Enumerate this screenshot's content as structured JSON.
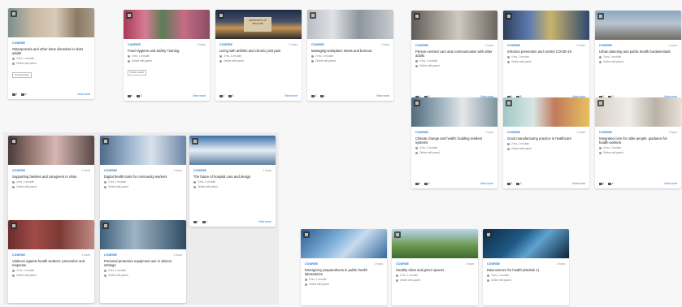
{
  "palette": {
    "accent": "#1a73c9",
    "page_background": "#f7f7f7",
    "panel_background": "#ececec",
    "card_background": "#ffffff"
  },
  "thumb_images": [
    "linear-gradient(90deg,#7a8f8c 0%,#c9b9a3 30%,#d8cbb8 55%,#8b7a63 80%,#a79c8a 100%)",
    "linear-gradient(90deg,#a93a57 0%,#d77b93 25%,#5b7c55 45%,#c56c87 70%,#8a4e63 100%)",
    "linear-gradient(180deg,#1f2b44 0%,#46506b 40%,#c79553 62%,#2a2a2a 100%)",
    "linear-gradient(90deg,#b9bdc4 0%,#dfe1e4 30%,#8e959d 60%,#c8ccd1 100%)",
    "linear-gradient(90deg,#5f5a55 0%,#a8a29a 35%,#cfc9c0 55%,#6a6560 100%)",
    "linear-gradient(90deg,#2f3e5a 0%,#5c7bb0 30%,#c9b36a 55%,#2e4870 100%)",
    "linear-gradient(180deg,#8aa6c3 0%,#b8c4cf 45%,#6f6a61 100%)",
    "linear-gradient(90deg,#4f6b7d 0%,#aebfc9 40%,#e5e8ea 60%,#7f949f 100%)",
    "linear-gradient(90deg,#9ec8c6 0%,#d9e6e5 35%,#c07a5a 60%,#e8c061 100%)",
    "linear-gradient(90deg,#d7d1c8 0%,#efece7 40%,#b9b1a5 70%,#e6e0d7 100%)",
    "linear-gradient(90deg,#4b3a38 0%,#9c7f78 30%,#d7b6b4 55%,#5a4844 100%)",
    "linear-gradient(90deg,#4f6a8a 0%,#9fb7d1 35%,#d8e2ec 60%,#6c86a6 100%)",
    "linear-gradient(180deg,#3a6fa8 0%,#e7eef5 50%,#5d7da0 100%)",
    "linear-gradient(90deg,#6b2c2b 0%,#a04c48 30%,#7d3a35 60%,#c08a84 100%)",
    "linear-gradient(90deg,#3e5f7a 0%,#9fb5c6 40%,#2f4b63 100%)",
    "linear-gradient(135deg,#2c5b8f 0%,#7fb0da 40%,#c7dcee 60%,#35689c 100%)",
    "linear-gradient(180deg,#b9d5ef 0%,#6d9a52 55%,#3f6a2e 100%)",
    "linear-gradient(135deg,#0f2a45 0%,#1f5a86 40%,#5fa2cf 60%,#0d2236 100%)"
  ],
  "thumb_label": {
    "line1": "MINISTRY OF",
    "line2": "HEALTH"
  },
  "cards": [
    {
      "category": "COURSE",
      "duration": "",
      "title": "Osteoporosis and other bone disorders in older adults",
      "info1": "4 hrs, 1 module",
      "info2": "Online self-paced",
      "tag": "Postgraduate",
      "views": "8",
      "likes": "8",
      "more": "View more"
    },
    {
      "category": "COURSE",
      "duration": "1 hours",
      "title": "Food Hygiene and Safety Training",
      "info1": "4 hrs, 1 module",
      "info2": "Online self-paced",
      "tag": "Public health",
      "views": "6",
      "likes": "8",
      "more": "View more"
    },
    {
      "category": "COURSE",
      "duration": "1 hours",
      "title": "Living with arthritis and chronic joint pain",
      "info1": "3 hrs, 1 module",
      "info2": "Online self-paced",
      "tag": "",
      "views": "4",
      "likes": "6",
      "more": "View more"
    },
    {
      "category": "COURSE",
      "duration": "1 hours",
      "title": "Managing workplace stress and burnout",
      "info1": "2 hrs, 1 module",
      "info2": "Online self-paced",
      "tag": "",
      "views": "3",
      "likes": "1",
      "more": "View more"
    },
    {
      "category": "COURSE",
      "duration": "1 hours",
      "title": "Person-centred care and communication with older adults",
      "info1": "4 hrs, 1 module",
      "info2": "Online self-paced",
      "tag": "",
      "views": "6",
      "likes": "5",
      "more": "View more"
    },
    {
      "category": "COURSE",
      "duration": "1 hours",
      "title": "Infection prevention and control COVID-19",
      "info1": "4 hrs, 1 module",
      "info2": "Online self-paced",
      "tag": "",
      "views": "8",
      "likes": "8",
      "more": "View more"
    },
    {
      "category": "COURSE",
      "duration": "1 hours",
      "title": "Urban planning and public health fundamentals",
      "info1": "3 hrs, 1 module",
      "info2": "Online self-paced",
      "tag": "",
      "views": "5",
      "likes": "3",
      "more": "View more"
    },
    {
      "category": "COURSE",
      "duration": "1 hours",
      "title": "Climate change and health: building resilient systems",
      "info1": "4 hrs, 1 module",
      "info2": "Online self-paced",
      "tag": "",
      "views": "6",
      "likes": "6",
      "more": "View more"
    },
    {
      "category": "COURSE",
      "duration": "1 hours",
      "title": "Good manufacturing practice in healthcare",
      "info1": "2 hrs, 1 module",
      "info2": "Online self-paced",
      "tag": "",
      "views": "3",
      "likes": "2",
      "more": "View more"
    },
    {
      "category": "COURSE",
      "duration": "1 hours",
      "title": "Integrated care for older people: guidance for health workers",
      "info1": "4 hrs, 1 module",
      "info2": "Online self-paced",
      "tag": "",
      "views": "4",
      "likes": "4",
      "more": "View more"
    },
    {
      "category": "COURSE",
      "duration": "1 hours",
      "title": "Supporting families and caregivers in crisis",
      "info1": "4 hrs, 1 module",
      "info2": "Online self-paced",
      "tag": "",
      "views": "4",
      "likes": "3",
      "more": "View more"
    },
    {
      "category": "COURSE",
      "duration": "1 hours",
      "title": "Digital health tools for community workers",
      "info1": "3 hrs, 1 module",
      "info2": "Online self-paced",
      "tag": "",
      "views": "3",
      "likes": "2",
      "more": "View more"
    },
    {
      "category": "COURSE",
      "duration": "1 hours",
      "title": "The future of hospital care and design",
      "info1": "3 hrs, 1 module",
      "info2": "Online self-paced",
      "tag": "",
      "views": "2",
      "likes": "1",
      "more": "View more"
    },
    {
      "category": "COURSE",
      "duration": "1 hours",
      "title": "Violence against health workers: prevention and response",
      "info1": "4 hrs, 1 module",
      "info2": "Online self-paced",
      "tag": "",
      "views": "3",
      "likes": "2",
      "more": "View more"
    },
    {
      "category": "COURSE",
      "duration": "1 hours",
      "title": "Personal protective equipment use in clinical settings",
      "info1": "4 hrs, 1 module",
      "info2": "Online self-paced",
      "tag": "",
      "views": "3",
      "likes": "4",
      "more": "View more"
    },
    {
      "category": "COURSE",
      "duration": "1 hours",
      "title": "Emergency preparedness in public health laboratories",
      "info1": "3 hrs, 1 module",
      "info2": "Online self-paced",
      "tag": "",
      "views": "5",
      "likes": "3",
      "more": "View more"
    },
    {
      "category": "COURSE",
      "duration": "1 hours",
      "title": "Healthy cities and green spaces",
      "info1": "2 hrs, 1 module",
      "info2": "Online self-paced",
      "tag": "",
      "views": "4",
      "likes": "1",
      "more": "View more"
    },
    {
      "category": "COURSE",
      "duration": "1 hours",
      "title": "Data science for health (Module 1)",
      "info1": "3 hrs, 1 module",
      "info2": "Online self-paced",
      "tag": "",
      "views": "3",
      "likes": "2",
      "more": "View more"
    }
  ]
}
